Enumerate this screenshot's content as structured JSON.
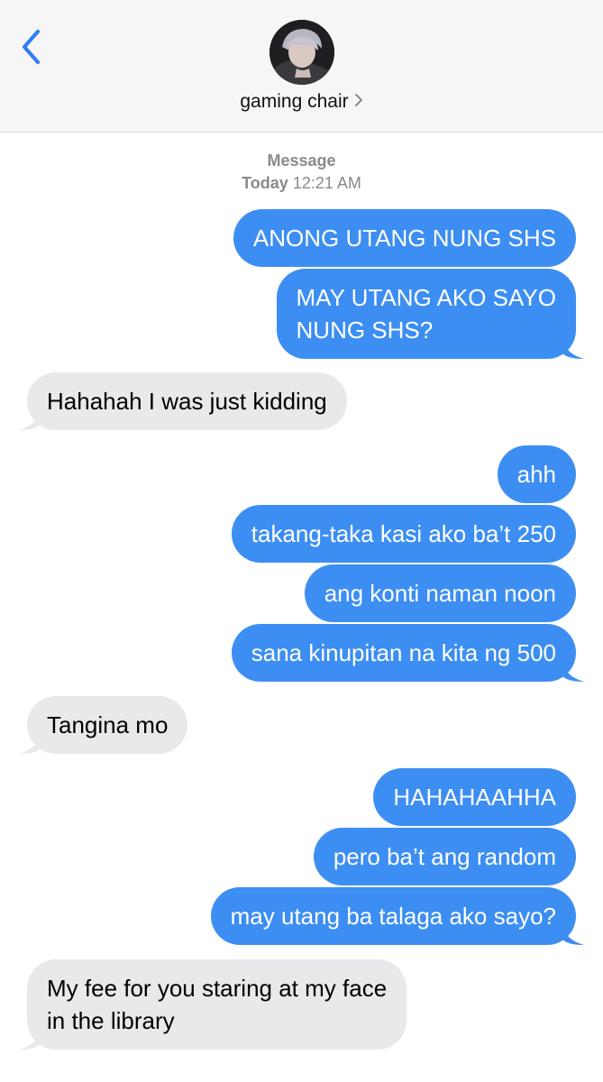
{
  "header": {
    "contact_name": "gaming chair",
    "back_icon": "chevron-left-icon",
    "chevron_icon": "chevron-right-icon"
  },
  "timestamp": {
    "service": "Message",
    "day": "Today",
    "time": "12:21 AM"
  },
  "colors": {
    "sent_bubble": "#3d8ef2",
    "received_bubble": "#e9e9eb",
    "accent": "#2f7cf6"
  },
  "messages": [
    {
      "from": "me",
      "text": "ANONG UTANG NUNG SHS"
    },
    {
      "from": "me",
      "text": "MAY UTANG AKO SAYO",
      "text2": "NUNG SHS?"
    },
    {
      "from": "them",
      "text": "Hahahah I was just kidding"
    },
    {
      "from": "me",
      "text": "ahh"
    },
    {
      "from": "me",
      "text": "takang-taka kasi ako ba’t 250"
    },
    {
      "from": "me",
      "text": "ang konti naman noon"
    },
    {
      "from": "me",
      "text": "sana kinupitan na kita ng 500"
    },
    {
      "from": "them",
      "text": "Tangina mo"
    },
    {
      "from": "me",
      "text": "HAHAHAAHHA"
    },
    {
      "from": "me",
      "text": "pero ba’t ang random"
    },
    {
      "from": "me",
      "text": "may utang ba talaga ako sayo?"
    },
    {
      "from": "them",
      "text": "My fee for you staring at my face",
      "text2": "in the library"
    }
  ]
}
